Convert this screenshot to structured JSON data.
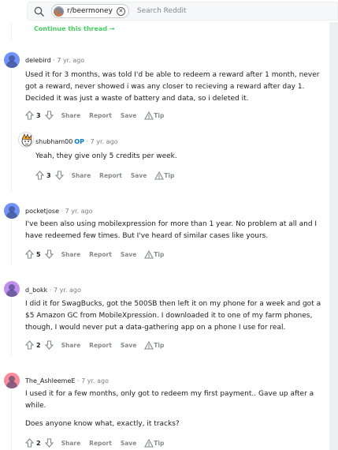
{
  "search": {
    "community": "r/beermoney",
    "placeholder": "Search Reddit"
  },
  "continue_thread": "Continue this thread",
  "actions": {
    "share": "Share",
    "report": "Report",
    "save": "Save",
    "tip": "Tip"
  },
  "comments": [
    {
      "user": "delebird",
      "age": "7 yr. ago",
      "lines": [
        "Used it for 3 months, was told I'd be able to redeem a reward after 1 month, never",
        "got a reward, never showed i was any closer to recieving a reward after day 1.",
        "Decided it was just a waste of battery and data, so i deleted it."
      ],
      "score": "3"
    },
    {
      "user": "shubham00",
      "op": "OP",
      "age": "7 yr. ago",
      "lines": [
        "Yeah, they give only 5 credits per week."
      ],
      "score": "3"
    },
    {
      "user": "pocketjose",
      "age": "7 yr. ago",
      "lines": [
        "I've been also using mobilexpression for more than 1 year. No problem at all and I",
        "have redeemed few times. But I've heard of similar cases like yours."
      ],
      "score": "5"
    },
    {
      "user": "d_bokk",
      "age": "7 yr. ago",
      "lines": [
        "I did it for SwagBucks, got the 500SB then left it on my phone for a week and got a",
        "$5 Amazon GC from MobileXpression. I downloaded it to one of my farm phones,",
        "though, I would never put a data-gathering app on a phone I use for real."
      ],
      "score": "2"
    },
    {
      "user": "The_AshleemeE",
      "age": "7 yr. ago",
      "lines": [
        "I used it for a few months, only got to redeem my first payment.. Gave up after a",
        "while."
      ],
      "lines2": [
        "Does anyone know what, exactly, it tracks?"
      ],
      "score": "2"
    }
  ]
}
